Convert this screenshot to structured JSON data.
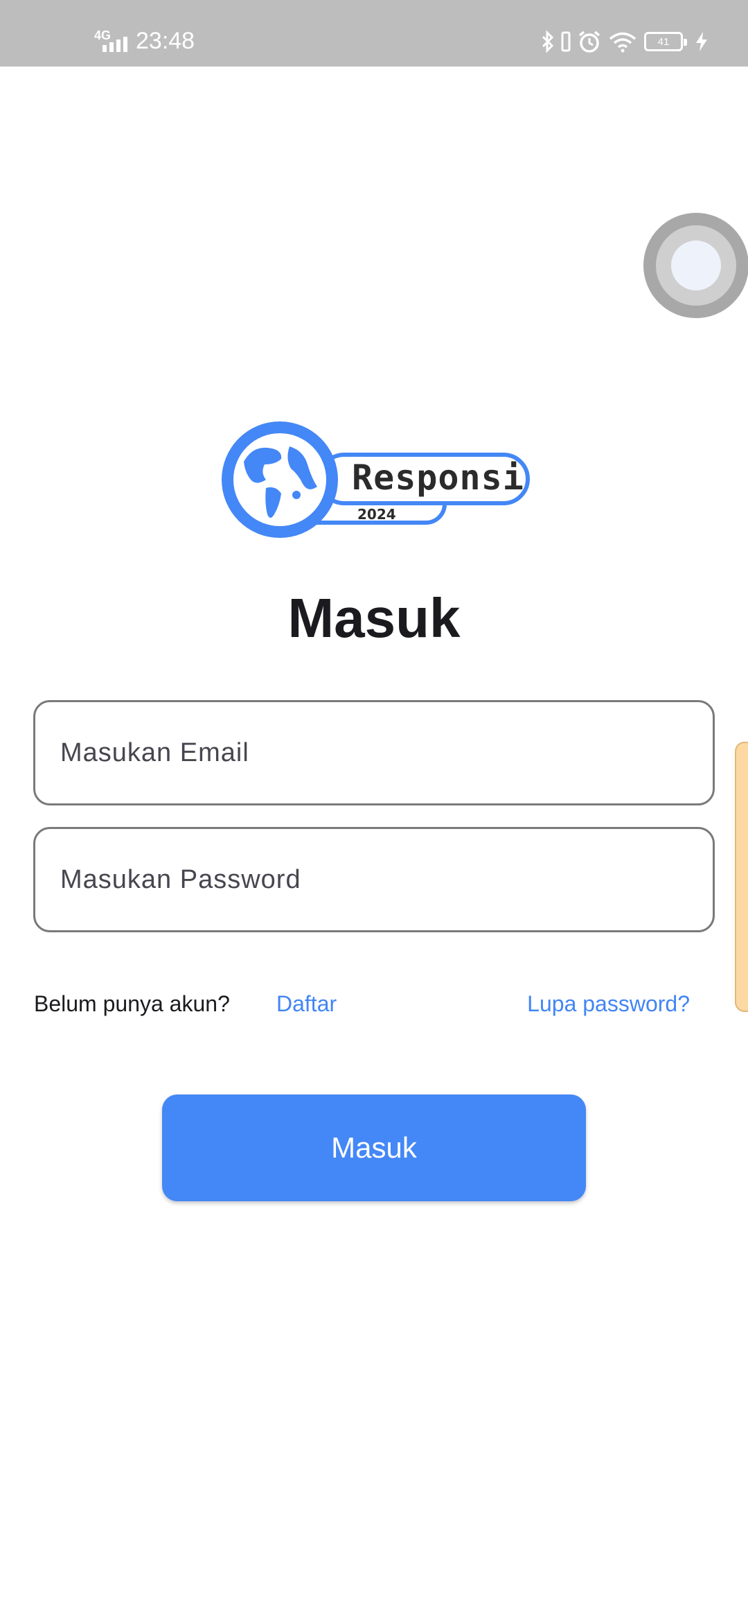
{
  "status_bar": {
    "network": "4G",
    "time": "23:48",
    "battery": "41"
  },
  "logo": {
    "wordmark": "Responsi",
    "year": "2024"
  },
  "login": {
    "title": "Masuk",
    "email_placeholder": "Masukan Email",
    "password_placeholder": "Masukan Password",
    "no_account_text": "Belum punya akun?",
    "register_link": "Daftar",
    "forgot_link": "Lupa password?",
    "submit_label": "Masuk"
  },
  "colors": {
    "accent": "#4285f4",
    "button": "#4487f6",
    "status_bar": "#bdbdbd",
    "text": "#1b1b1f"
  },
  "icons": [
    "bluetooth-icon",
    "vibrate-icon",
    "alarm-icon",
    "wifi-icon",
    "battery-icon",
    "charging-icon",
    "signal-icon",
    "globe-icon"
  ]
}
